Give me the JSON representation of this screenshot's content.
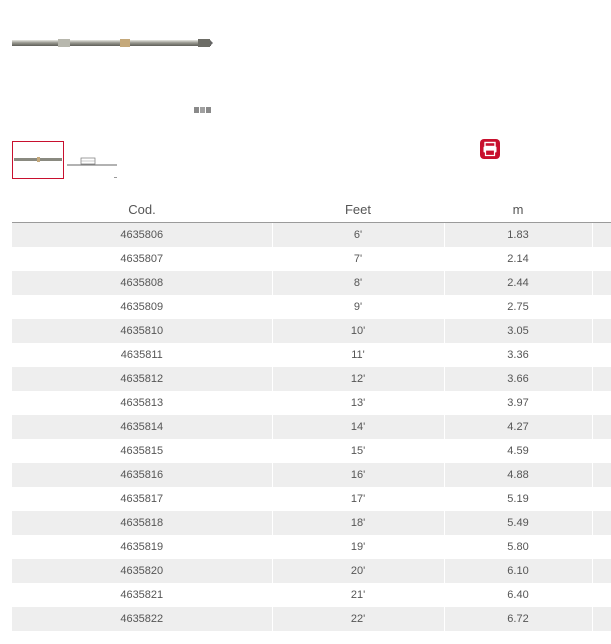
{
  "gallery": {
    "main_image": "tubular-stanchion-rod-image",
    "thumbnails": [
      "stanchion-rod-thumbnail",
      "rod-dimension-drawing-thumbnail"
    ]
  },
  "actions": {
    "pdf_icon": "pdf-print-icon",
    "accent_color": "#c8102e"
  },
  "table": {
    "headers": {
      "code": "Cod.",
      "feet": "Feet",
      "meters": "m"
    },
    "rows": [
      {
        "code": "4635806",
        "feet": "6'",
        "m": "1.83"
      },
      {
        "code": "4635807",
        "feet": "7'",
        "m": "2.14"
      },
      {
        "code": "4635808",
        "feet": "8'",
        "m": "2.44"
      },
      {
        "code": "4635809",
        "feet": "9'",
        "m": "2.75"
      },
      {
        "code": "4635810",
        "feet": "10'",
        "m": "3.05"
      },
      {
        "code": "4635811",
        "feet": "11'",
        "m": "3.36"
      },
      {
        "code": "4635812",
        "feet": "12'",
        "m": "3.66"
      },
      {
        "code": "4635813",
        "feet": "13'",
        "m": "3.97"
      },
      {
        "code": "4635814",
        "feet": "14'",
        "m": "4.27"
      },
      {
        "code": "4635815",
        "feet": "15'",
        "m": "4.59"
      },
      {
        "code": "4635816",
        "feet": "16'",
        "m": "4.88"
      },
      {
        "code": "4635817",
        "feet": "17'",
        "m": "5.19"
      },
      {
        "code": "4635818",
        "feet": "18'",
        "m": "5.49"
      },
      {
        "code": "4635819",
        "feet": "19'",
        "m": "5.80"
      },
      {
        "code": "4635820",
        "feet": "20'",
        "m": "6.10"
      },
      {
        "code": "4635821",
        "feet": "21'",
        "m": "6.40"
      },
      {
        "code": "4635822",
        "feet": "22'",
        "m": "6.72"
      }
    ]
  }
}
